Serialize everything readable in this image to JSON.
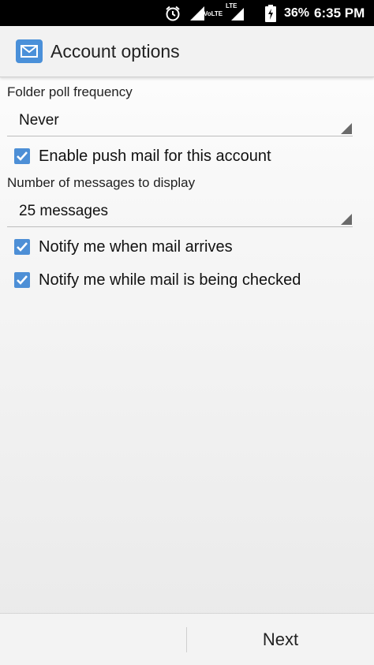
{
  "status_bar": {
    "network_volte": "VoLTE",
    "network_lte": "LTE",
    "battery_percent": "36%",
    "time": "6:35 PM",
    "icons": [
      "alarm-icon",
      "signal-icon",
      "signal-icon",
      "battery-charging-icon"
    ]
  },
  "action_bar": {
    "title": "Account options",
    "icon": "mail-icon",
    "accent_color": "#4a90d9"
  },
  "settings": {
    "poll_label": "Folder poll frequency",
    "poll_value": "Never",
    "push_mail_label": "Enable push mail for this account",
    "push_mail_checked": true,
    "messages_label": "Number of messages to display",
    "messages_value": "25 messages",
    "notify_arrive_label": "Notify me when mail arrives",
    "notify_arrive_checked": true,
    "notify_checking_label": "Notify me while mail is being checked",
    "notify_checking_checked": true
  },
  "footer": {
    "next_label": "Next"
  }
}
